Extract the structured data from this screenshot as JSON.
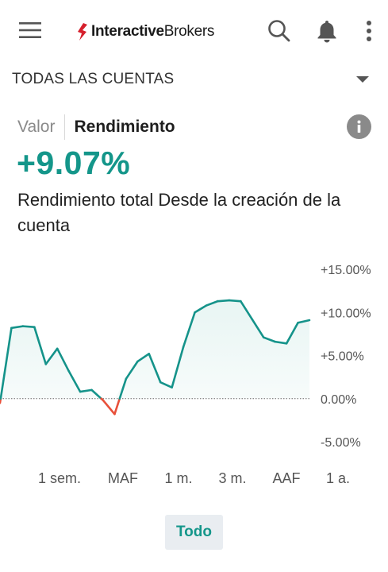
{
  "header": {
    "logo_bold": "Interactive",
    "logo_regular": "Brokers",
    "icons": [
      "hamburger-menu-icon",
      "search-icon",
      "bell-icon",
      "more-vertical-icon"
    ]
  },
  "account": {
    "label": "TODAS LAS CUENTAS"
  },
  "tabs": {
    "value": "Valor",
    "performance": "Rendimiento"
  },
  "summary": {
    "percent": "+9.07%",
    "description": "Rendimiento total Desde la creación de la cuenta"
  },
  "colors": {
    "accent": "#14968a",
    "line": "#15938a",
    "negative": "#e8503a",
    "fill": "#e8f5f3"
  },
  "chart_data": {
    "type": "line",
    "y_tick_labels": [
      "+15.00%",
      "+10.00%",
      "+5.00%",
      "0.00%",
      "-5.00%"
    ],
    "y_ticks": [
      15,
      10,
      5,
      0,
      -5
    ],
    "ylim": [
      -5,
      15
    ],
    "baseline": 0,
    "series": [
      {
        "values": [
          -0.5,
          8.2,
          8.4,
          8.3,
          4.0,
          5.8,
          3.2,
          0.8,
          1.0,
          -0.2,
          -1.8,
          2.3,
          4.3,
          5.2,
          1.9,
          1.3,
          6.0,
          10.0,
          10.8,
          11.3,
          11.4,
          11.3,
          9.2,
          7.1,
          6.6,
          6.4,
          8.8,
          9.1
        ]
      }
    ]
  },
  "ranges": [
    "1 sem.",
    "MAF",
    "1 m.",
    "3 m.",
    "AAF",
    "1 a."
  ],
  "selected_range": "Todo"
}
